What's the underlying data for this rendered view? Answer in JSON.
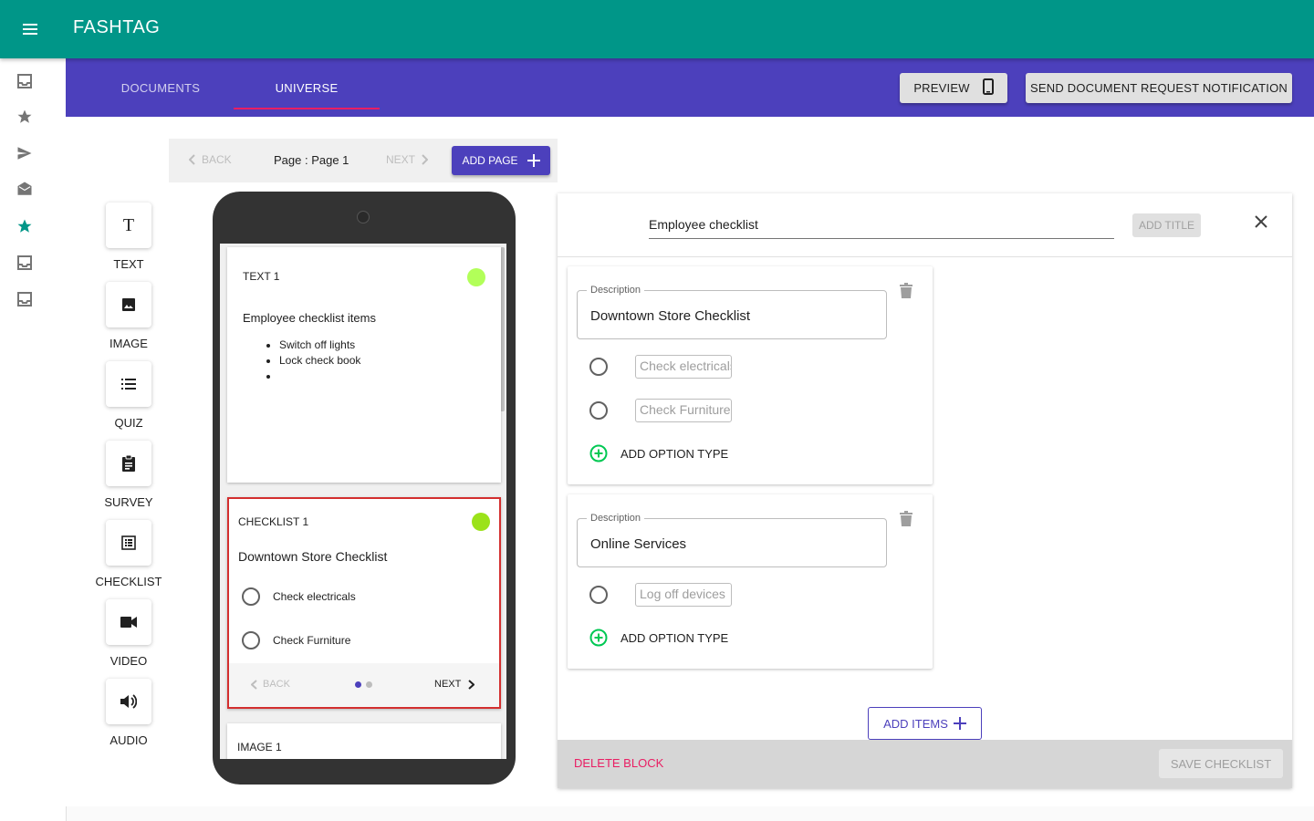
{
  "app": {
    "title": "FASHTAG"
  },
  "colors": {
    "appbar": "#009688",
    "tabbar": "#4c40bc",
    "accent": "#e91e63",
    "status_dot": "#b2ff59"
  },
  "rail": {
    "items": [
      {
        "icon": "inbox-icon"
      },
      {
        "icon": "star-icon"
      },
      {
        "icon": "send-icon"
      },
      {
        "icon": "drafts-icon"
      },
      {
        "icon": "star-icon",
        "active": true
      },
      {
        "icon": "inbox-icon"
      },
      {
        "icon": "inbox-icon"
      }
    ]
  },
  "tabs": [
    {
      "label": "DOCUMENTS",
      "active": false
    },
    {
      "label": "UNIVERSE",
      "active": true
    }
  ],
  "toolbar": {
    "preview_label": "PREVIEW",
    "send_label": "SEND DOCUMENT REQUEST NOTIFICATION"
  },
  "page_nav": {
    "back_label": "BACK",
    "page_label": "Page : Page 1",
    "next_label": "NEXT",
    "add_page_label": "ADD PAGE"
  },
  "tools": [
    {
      "label": "TEXT",
      "icon": "text-icon"
    },
    {
      "label": "IMAGE",
      "icon": "image-icon"
    },
    {
      "label": "QUIZ",
      "icon": "list-icon"
    },
    {
      "label": "SURVEY",
      "icon": "clipboard-icon"
    },
    {
      "label": "CHECKLIST",
      "icon": "checklist-icon"
    },
    {
      "label": "VIDEO",
      "icon": "video-icon"
    },
    {
      "label": "AUDIO",
      "icon": "volume-icon"
    }
  ],
  "phone": {
    "text_block": {
      "title": "TEXT 1",
      "heading": "Employee checklist items",
      "bullets": [
        "Switch off lights",
        "Lock check book",
        ""
      ]
    },
    "checklist_block": {
      "title": "CHECKLIST 1",
      "heading": "Downtown Store Checklist",
      "options": [
        "Check electricals",
        "Check Furniture"
      ],
      "back_label": "BACK",
      "next_label": "NEXT"
    },
    "image_block": {
      "title": "IMAGE 1"
    }
  },
  "editor": {
    "title_value": "Employee checklist",
    "add_title_label": "ADD TITLE",
    "items": [
      {
        "legend": "Description",
        "value": "Downtown Store Checklist",
        "options": [
          "Check electricals",
          "Check Furniture"
        ],
        "add_option_label": "ADD OPTION TYPE"
      },
      {
        "legend": "Description",
        "value": "Online Services",
        "options": [
          "Log off devices"
        ],
        "add_option_label": "ADD OPTION TYPE"
      }
    ],
    "add_items_label": "ADD ITEMS",
    "delete_label": "DELETE BLOCK",
    "save_label": "SAVE CHECKLIST"
  }
}
